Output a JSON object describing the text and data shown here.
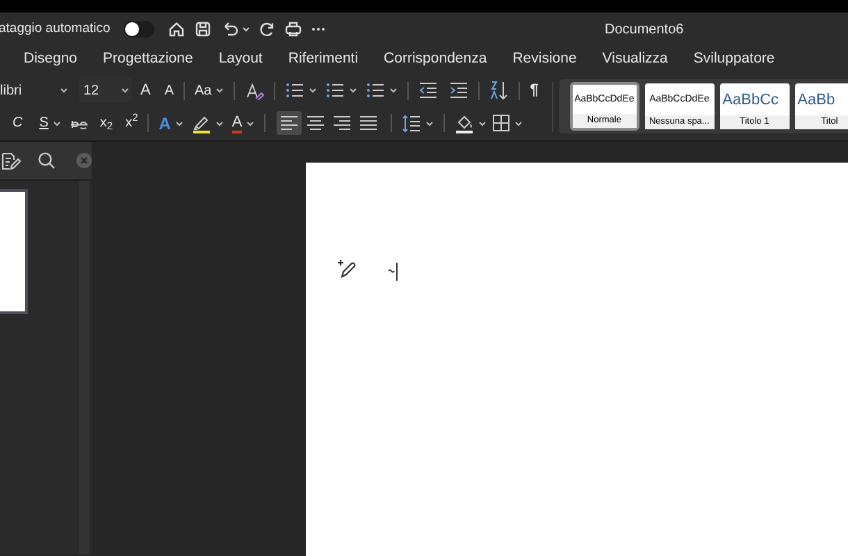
{
  "title_bar": {
    "autosave_label": "ataggio automatico",
    "autosave_on": false,
    "document_title": "Documento6"
  },
  "menu_tabs": [
    {
      "label": "Disegno",
      "selected": false
    },
    {
      "label": "Progettazione",
      "selected": false
    },
    {
      "label": "Layout",
      "selected": false
    },
    {
      "label": "Riferimenti",
      "selected": false
    },
    {
      "label": "Corrispondenza",
      "selected": false
    },
    {
      "label": "Revisione",
      "selected": false
    },
    {
      "label": "Visualizza",
      "selected": false
    },
    {
      "label": "Sviluppatore",
      "selected": false
    }
  ],
  "font": {
    "name": "libri",
    "size": "12",
    "grow": "A",
    "shrink": "A",
    "change_case": "Aa",
    "italic": "C",
    "underline": "S",
    "subscript": "x$_{2}$",
    "superscript": "x$^{2}$",
    "text_effects": "A",
    "font_color": "A"
  },
  "alignment": [
    {
      "kind": "left",
      "selected": true
    },
    {
      "kind": "center",
      "selected": false
    },
    {
      "kind": "right",
      "selected": false
    },
    {
      "kind": "justify",
      "selected": false
    }
  ],
  "pilcrow": "¶",
  "styles": [
    {
      "preview": "AaBbCcDdEe",
      "name": "Normale",
      "kind": "body",
      "selected": true
    },
    {
      "preview": "AaBbCcDdEe",
      "name": "Nessuna spa...",
      "kind": "body",
      "selected": false
    },
    {
      "preview": "AaBbCc",
      "name": "Titolo 1",
      "kind": "heading",
      "selected": false
    },
    {
      "preview": "AaBb",
      "name": "Titol",
      "kind": "heading",
      "selected": false
    }
  ]
}
